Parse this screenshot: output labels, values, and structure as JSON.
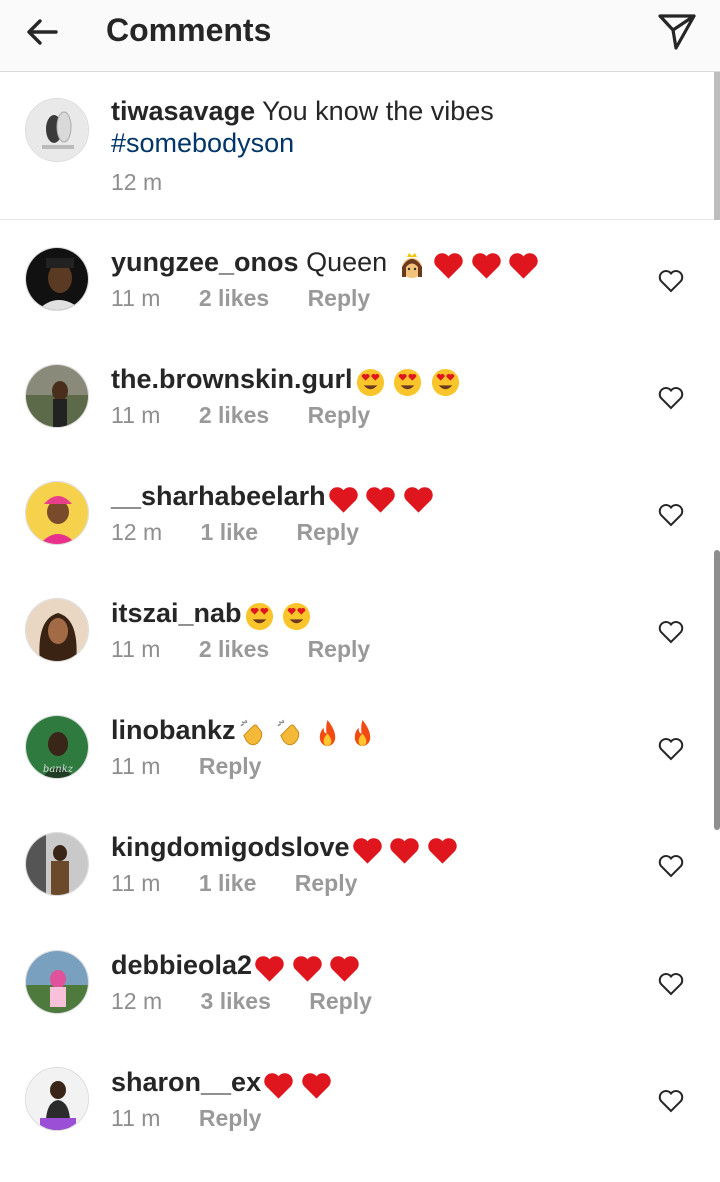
{
  "header": {
    "title": "Comments",
    "back_icon": "arrow-left-icon",
    "send_icon": "paper-plane-icon"
  },
  "caption": {
    "username": "tiwasavage",
    "text": "You know the vibes",
    "hashtag": "#somebodyson",
    "time": "12 m"
  },
  "comments": [
    {
      "username": "yungzee_onos",
      "text": "Queen",
      "emojis": [
        "princess",
        "heart",
        "heart",
        "heart"
      ],
      "time": "11 m",
      "likes": "2 likes",
      "reply": "Reply"
    },
    {
      "username": "the.brownskin.gurl",
      "text": "",
      "emojis": [
        "heart-eyes",
        "heart-eyes",
        "heart-eyes"
      ],
      "time": "11 m",
      "likes": "2 likes",
      "reply": "Reply"
    },
    {
      "username": "__sharhabeelarh",
      "text": "",
      "emojis": [
        "heart",
        "heart",
        "heart"
      ],
      "time": "12 m",
      "likes": "1 like",
      "reply": "Reply"
    },
    {
      "username": "itszai_nab",
      "text": "",
      "emojis": [
        "heart-eyes",
        "heart-eyes"
      ],
      "time": "11 m",
      "likes": "2 likes",
      "reply": "Reply"
    },
    {
      "username": "linobankz",
      "text": "",
      "emojis": [
        "clap",
        "clap",
        "fire",
        "fire"
      ],
      "time": "11 m",
      "likes": "",
      "reply": "Reply"
    },
    {
      "username": "kingdomigodslove",
      "text": "",
      "emojis": [
        "heart",
        "heart",
        "heart"
      ],
      "time": "11 m",
      "likes": "1 like",
      "reply": "Reply"
    },
    {
      "username": "debbieola2",
      "text": "",
      "emojis": [
        "heart",
        "heart",
        "heart"
      ],
      "time": "12 m",
      "likes": "3 likes",
      "reply": "Reply"
    },
    {
      "username": "sharon__ex",
      "text": "",
      "emojis": [
        "heart",
        "heart"
      ],
      "time": "11 m",
      "likes": "",
      "reply": "Reply"
    }
  ],
  "colors": {
    "text": "#262626",
    "muted": "#8e8e8e",
    "hashtag": "#003569",
    "heart": "#e0161f"
  }
}
